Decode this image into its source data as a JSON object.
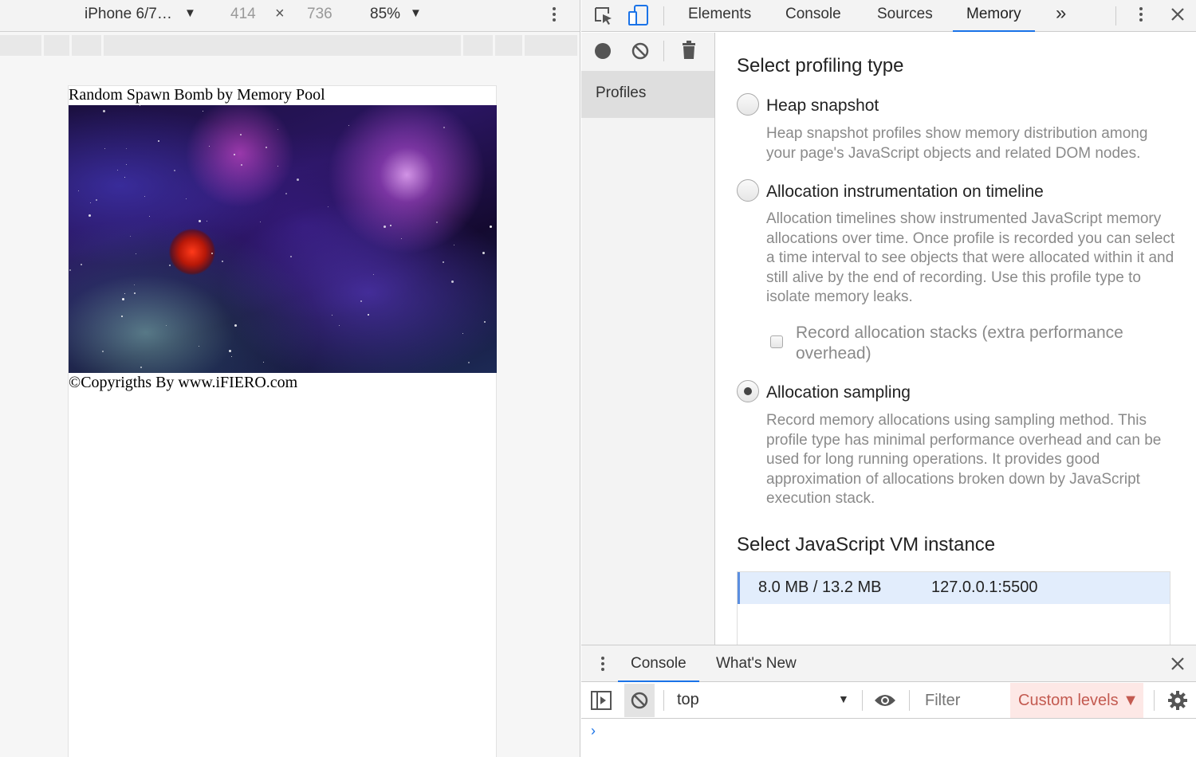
{
  "device_toolbar": {
    "device_name": "iPhone 6/7…",
    "width": "414",
    "times": "×",
    "height": "736",
    "zoom": "85%",
    "caret": "▼"
  },
  "page": {
    "title": "Random Spawn Bomb by Memory Pool",
    "copyright": "©Copyrigths By www.iFIERO.com"
  },
  "devtools": {
    "tabs": [
      "Elements",
      "Console",
      "Sources",
      "Memory"
    ],
    "more": "»",
    "sidebar": {
      "profiles": "Profiles"
    },
    "profiling": {
      "title": "Select profiling type",
      "options": [
        {
          "label": "Heap snapshot",
          "desc": "Heap snapshot profiles show memory distribution among your page's JavaScript objects and related DOM nodes.",
          "checked": false
        },
        {
          "label": "Allocation instrumentation on timeline",
          "desc": "Allocation timelines show instrumented JavaScript memory allocations over time. Once profile is recorded you can select a time interval to see objects that were allocated within it and still alive by the end of recording. Use this profile type to isolate memory leaks.",
          "checked": false
        },
        {
          "label": "Allocation sampling",
          "desc": "Record memory allocations using sampling method. This profile type has minimal performance overhead and can be used for long running operations. It provides good approximation of allocations broken down by JavaScript execution stack.",
          "checked": true
        }
      ],
      "record_stacks": "Record allocation stacks (extra performance overhead)",
      "vm_title": "Select JavaScript VM instance",
      "vm": {
        "memory": "8.0 MB / 13.2 MB",
        "host": "127.0.0.1:5500"
      }
    },
    "drawer": {
      "tabs": [
        "Console",
        "What's New"
      ],
      "context": "top",
      "filter_placeholder": "Filter",
      "levels": "Custom levels ▼",
      "prompt": "›"
    }
  },
  "colors": {
    "accent": "#1a73e8",
    "selected_row": "#e2edfc",
    "levels_bg": "#fde8e6"
  }
}
